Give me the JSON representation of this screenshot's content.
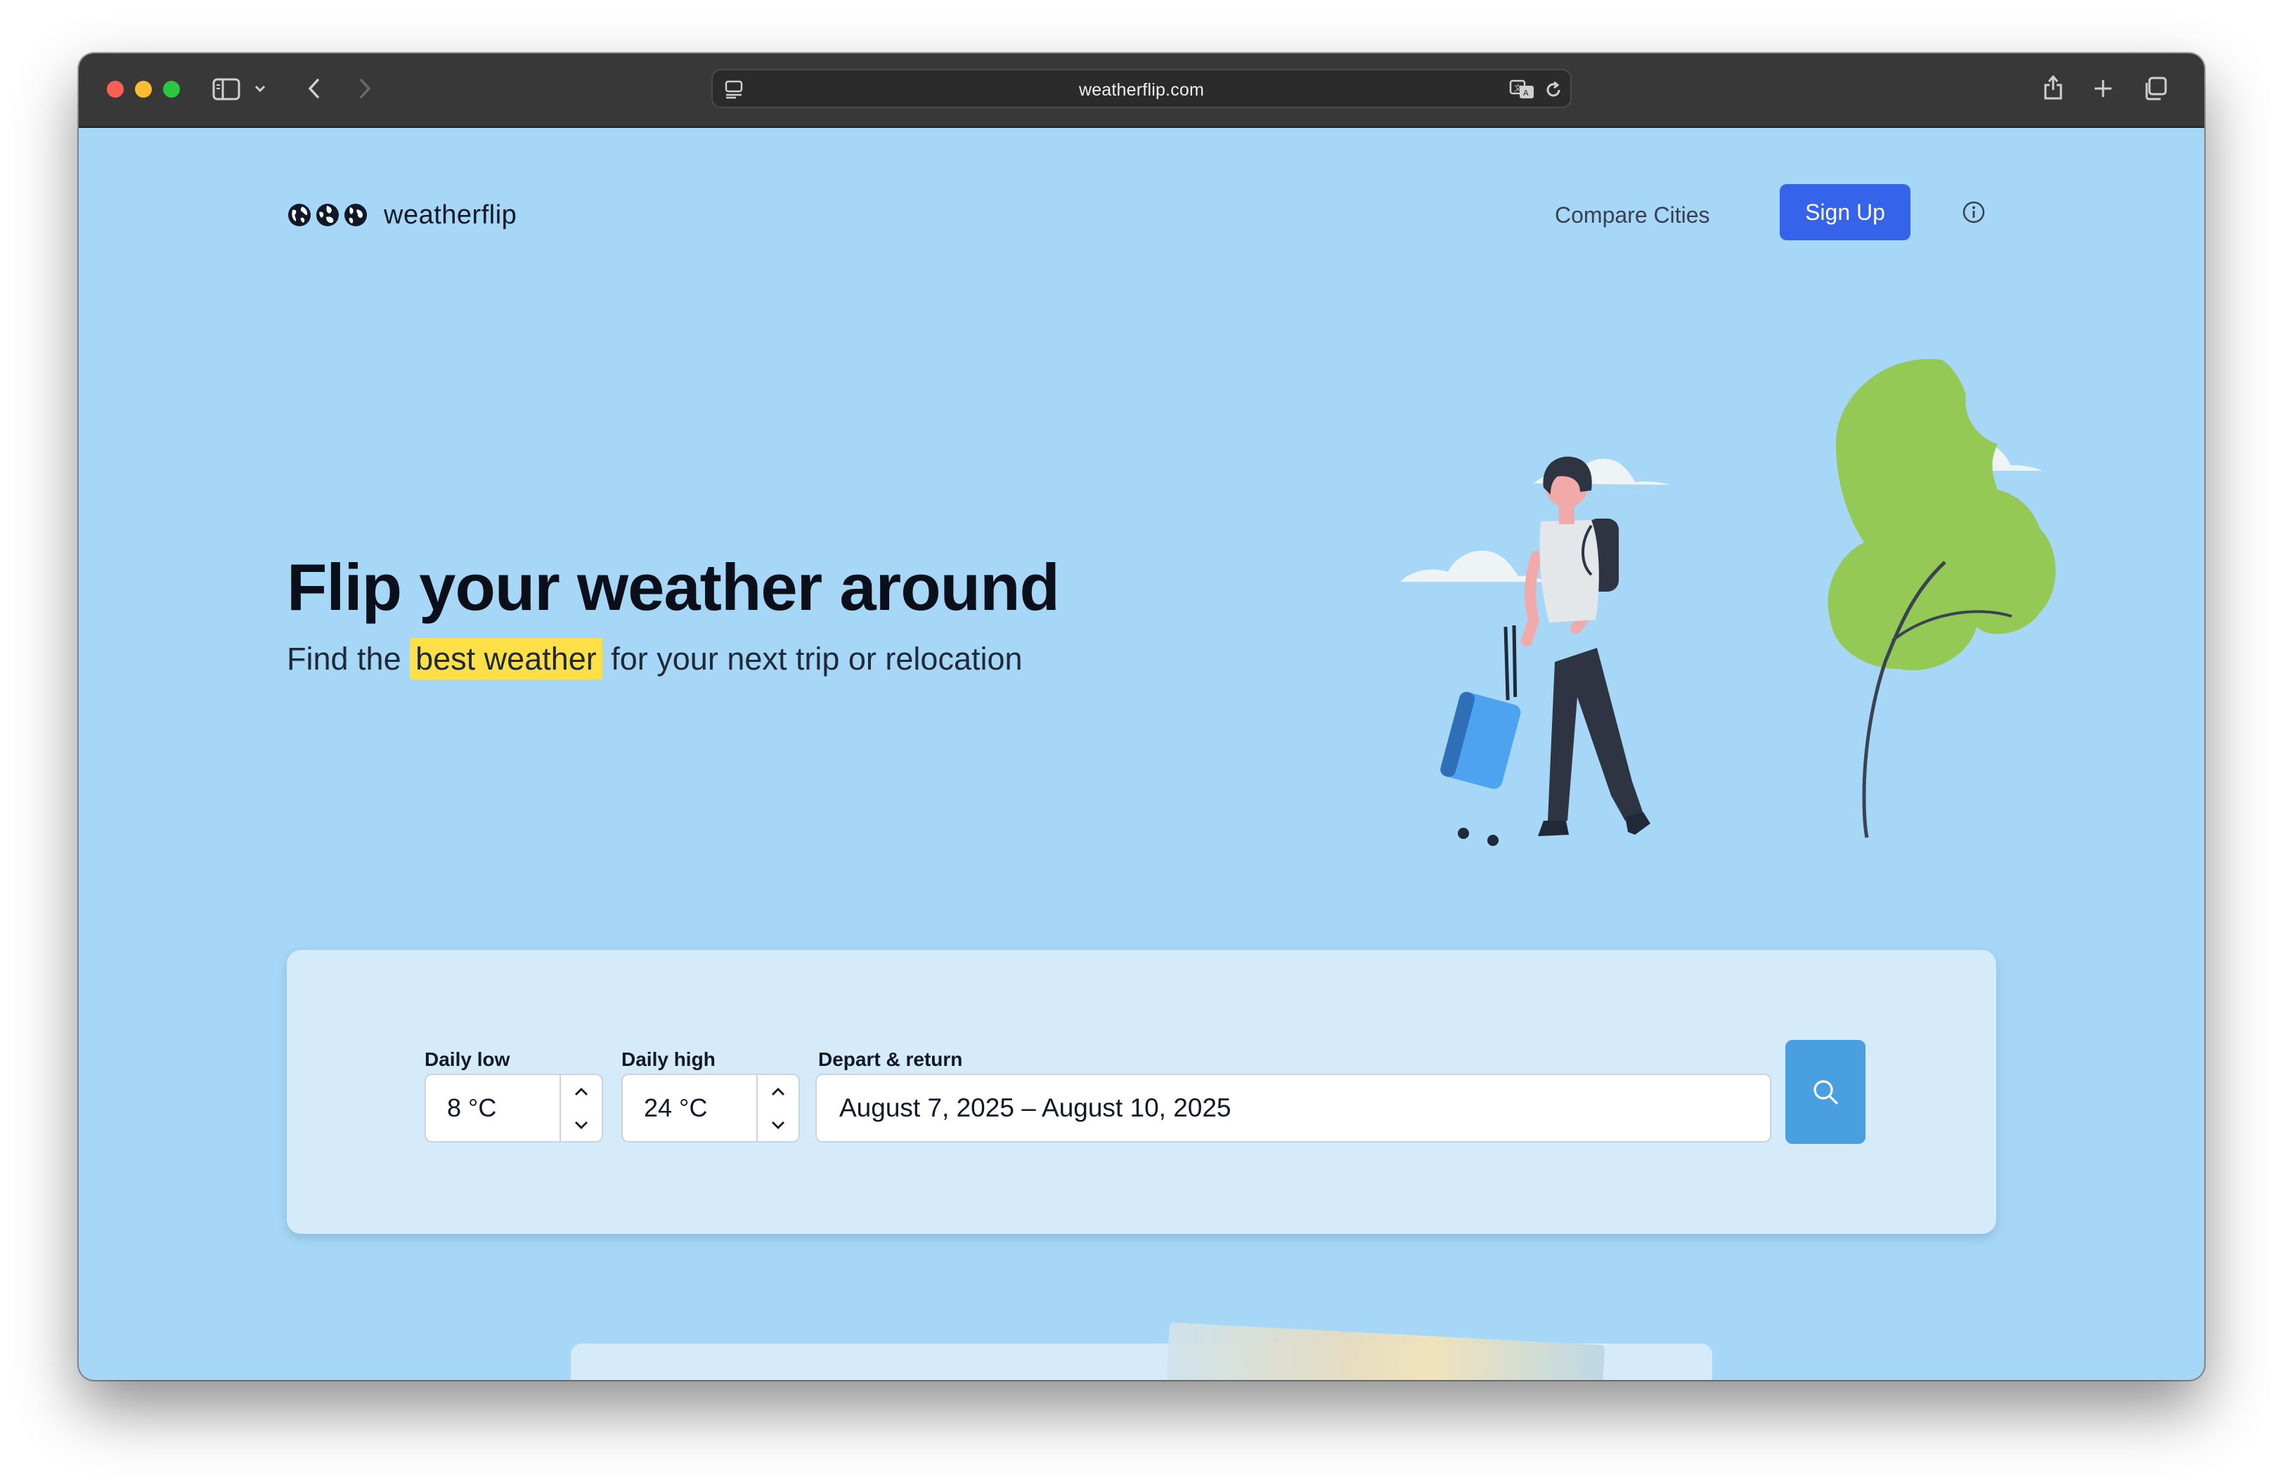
{
  "browser": {
    "url": "weatherflip.com"
  },
  "header": {
    "brand": "weatherflip",
    "nav_compare": "Compare Cities",
    "signup_label": "Sign Up"
  },
  "hero": {
    "title": "Flip your weather around",
    "subtitle_before": "Find the ",
    "subtitle_highlight": "best weather",
    "subtitle_after": " for your next trip or relocation"
  },
  "search": {
    "low_label": "Daily low",
    "low_value": "8 °C",
    "high_label": "Daily high",
    "high_value": "24 °C",
    "dates_label": "Depart & return",
    "dates_value": "August 7, 2025 – August 10, 2025"
  },
  "colors": {
    "page_bg": "#a6d7f7",
    "card_bg": "#d6ebfa",
    "primary": "#3563e9",
    "search_button": "#4a9fe0",
    "highlight": "#fde047",
    "tree": "#95c955",
    "suitcase": "#4da3f0"
  },
  "icons": [
    "sidebar-icon",
    "chevron-down-icon",
    "back-icon",
    "forward-icon",
    "reader-icon",
    "translate-icon",
    "reload-icon",
    "share-icon",
    "new-tab-icon",
    "tabs-icon",
    "globe-icon",
    "info-icon",
    "chevron-up-icon",
    "search-icon"
  ]
}
